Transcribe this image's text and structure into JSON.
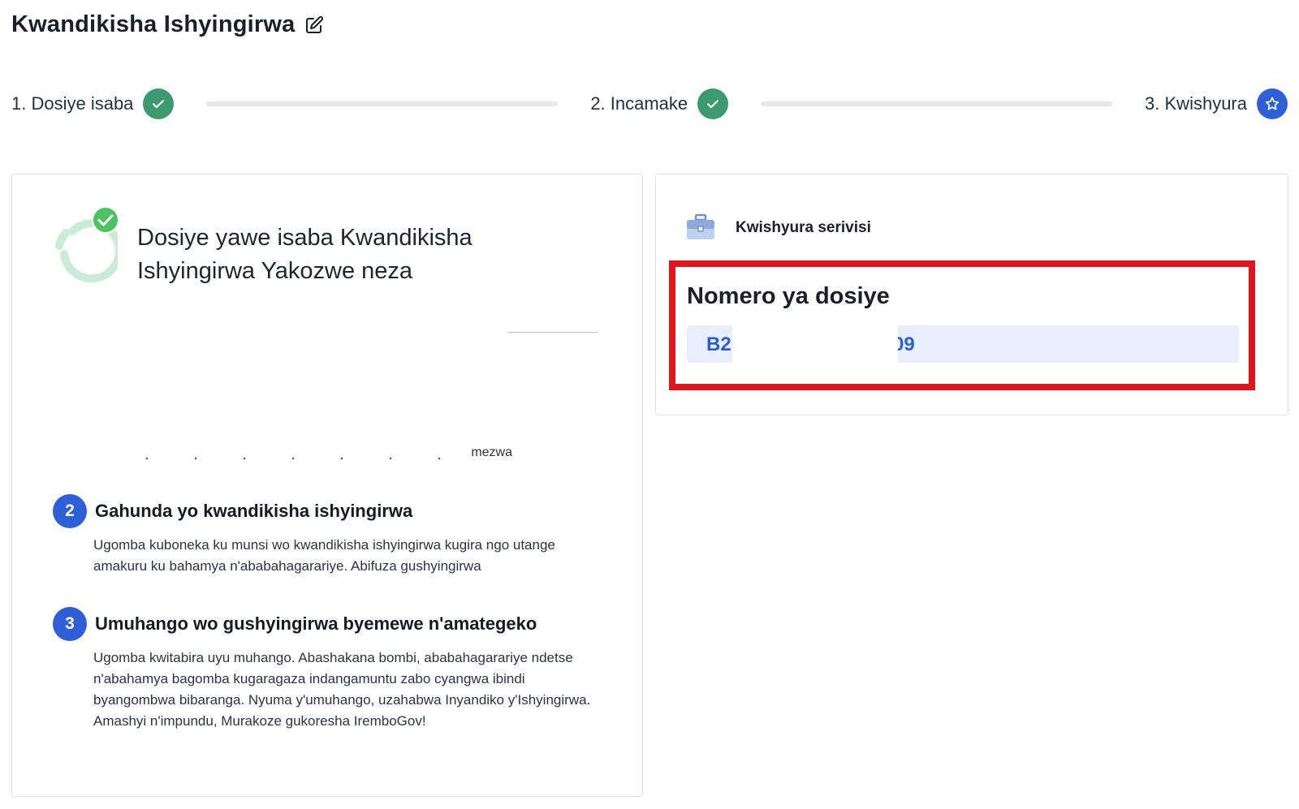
{
  "header": {
    "title": "Kwandikisha Ishyingirwa",
    "edit_icon": "edit-icon"
  },
  "stepper": {
    "steps": [
      {
        "label": "1. Dosiye isaba",
        "status": "done",
        "icon": "check-icon"
      },
      {
        "label": "2. Incamake",
        "status": "done",
        "icon": "check-icon"
      },
      {
        "label": "3. Kwishyura",
        "status": "current",
        "icon": "star-icon"
      }
    ]
  },
  "left_card": {
    "success_message": "Dosiye yawe isaba Kwandikisha Ishyingirwa Yakozwe neza",
    "cut_text_fragment": "mezwa",
    "sections": [
      {
        "number": "2",
        "title": "Gahunda yo kwandikisha ishyingirwa",
        "body": "Ugomba kuboneka ku munsi wo kwandikisha ishyingirwa kugira ngo utange amakuru ku bahamya n'ababahagarariye. Abifuza gushyingirwa"
      },
      {
        "number": "3",
        "title": "Umuhango wo gushyingirwa byemewe n'amategeko",
        "body": "Ugomba kwitabira uyu muhango. Abashakana bombi, ababahagarariye ndetse n'abahamya bagomba kugaragaza indangamuntu zabo cyangwa ibindi byangombwa bibaranga. Nyuma y'umuhango, uzahabwa Inyandiko y'Ishyingirwa. Amashyi n'impundu, Murakoze gukoresha IremboGov!"
      }
    ]
  },
  "right_card": {
    "pay_label": "Kwishyura serivisi",
    "file_title": "Nomero ya dosiye",
    "file_number_prefix": "B2",
    "file_number_suffix": "09"
  },
  "colors": {
    "done": "#3c9a6e",
    "current": "#2f5fd6",
    "highlight": "#e2141b",
    "field_bg": "#e8eefc"
  }
}
